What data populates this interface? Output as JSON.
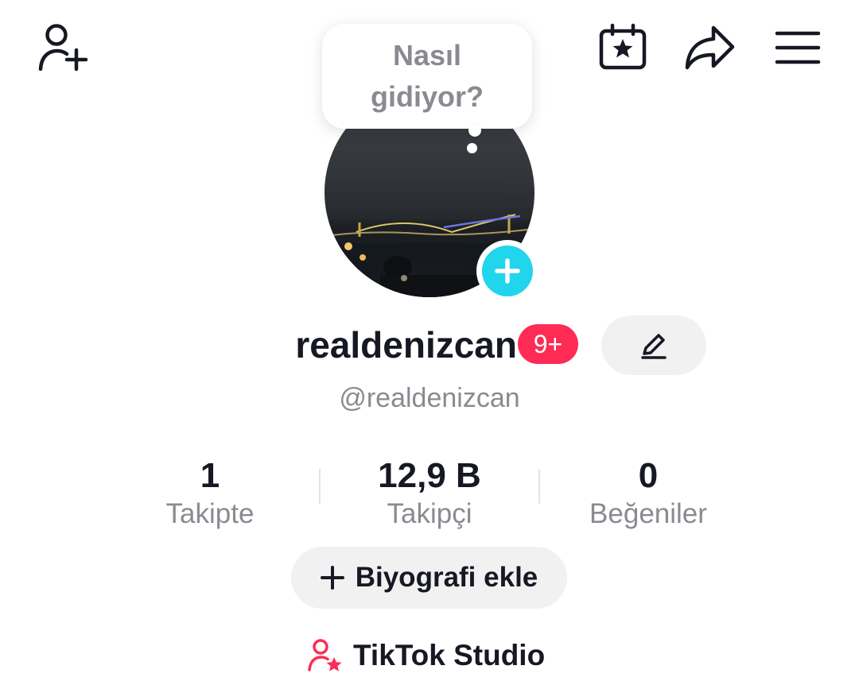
{
  "header": {
    "add_friend_icon": "person-add-icon",
    "calendar_icon": "calendar-star-icon",
    "share_icon": "share-arrow-icon",
    "menu_icon": "hamburger-menu-icon"
  },
  "thought_bubble": {
    "line1": "Nasıl",
    "line2": "gidiyor?"
  },
  "profile": {
    "username": "realdenizcan",
    "notification_badge": "9+",
    "handle": "@realdenizcan",
    "accent_color": "#20d5ec",
    "badge_color": "#fe2c55"
  },
  "stats": [
    {
      "value": "1",
      "label": "Takipte"
    },
    {
      "value": "12,9 B",
      "label": "Takipçi"
    },
    {
      "value": "0",
      "label": "Beğeniler"
    }
  ],
  "actions": {
    "add_bio_label": "Biyografi ekle",
    "studio_label": "TikTok Studio"
  }
}
